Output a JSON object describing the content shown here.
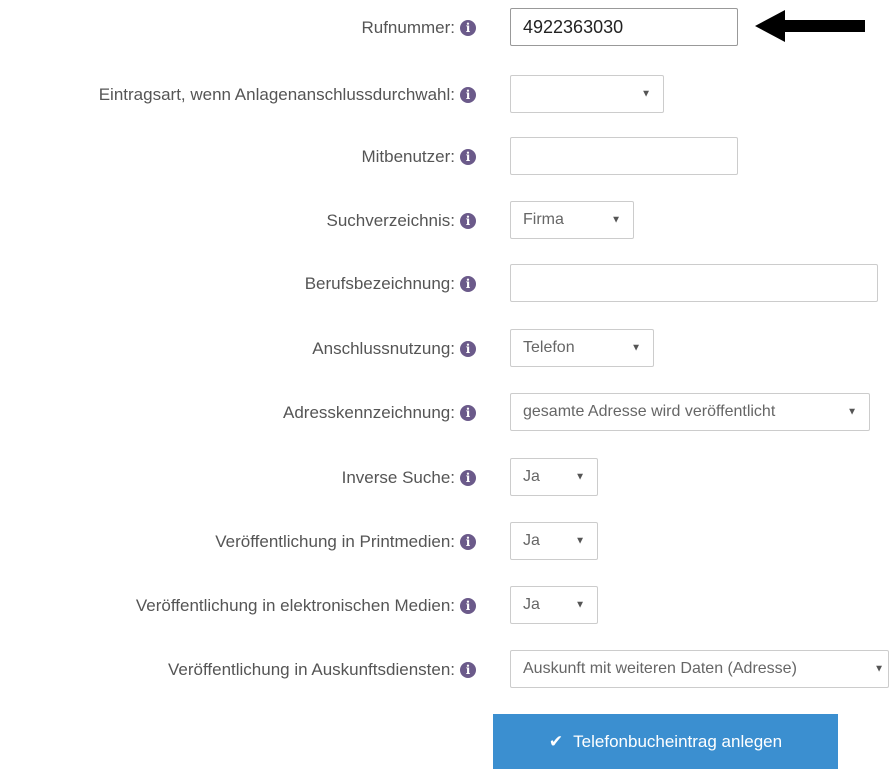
{
  "form": {
    "rufnummer": {
      "label": "Rufnummer:",
      "value": "4922363030"
    },
    "eintragsart": {
      "label": "Eintragsart, wenn Anlagenanschlussdurchwahl:",
      "value": ""
    },
    "mitbenutzer": {
      "label": "Mitbenutzer:",
      "value": ""
    },
    "suchverzeichnis": {
      "label": "Suchverzeichnis:",
      "value": "Firma"
    },
    "berufsbezeichnung": {
      "label": "Berufsbezeichnung:",
      "value": ""
    },
    "anschlussnutzung": {
      "label": "Anschlussnutzung:",
      "value": "Telefon"
    },
    "adresskennzeichnung": {
      "label": "Adresskennzeichnung:",
      "value": "gesamte Adresse wird veröffentlicht"
    },
    "inverse_suche": {
      "label": "Inverse Suche:",
      "value": "Ja"
    },
    "printmedien": {
      "label": "Veröffentlichung in Printmedien:",
      "value": "Ja"
    },
    "elektronische_medien": {
      "label": "Veröffentlichung in elektronischen Medien:",
      "value": "Ja"
    },
    "auskunftsdienste": {
      "label": "Veröffentlichung in Auskunftsdiensten:",
      "value": "Auskunft mit weiteren Daten (Adresse)"
    }
  },
  "submit": {
    "label": "Telefonbucheintrag anlegen",
    "icon": "check-icon"
  },
  "icons": {
    "info": "ℹ",
    "info_icon": "info-icon",
    "select_caret": "▼"
  },
  "colors": {
    "button": "#3b8fd0",
    "info_icon": "#6b5a8a"
  }
}
